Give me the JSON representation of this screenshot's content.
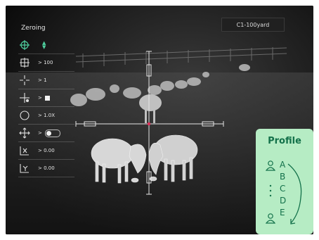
{
  "menu": {
    "title": "Zeroing",
    "items": [
      {
        "icon": "zero-reticle-icon",
        "value": "",
        "active": true
      },
      {
        "icon": "distance-icon",
        "value": "> 100",
        "active": false
      },
      {
        "icon": "reticle-type-icon",
        "value": "> 1",
        "active": false
      },
      {
        "icon": "reticle-color-icon",
        "value": ">",
        "active": false
      },
      {
        "icon": "zoom-circle-icon",
        "value": "> 1.0X",
        "active": false
      },
      {
        "icon": "freeze-icon",
        "value": ">",
        "active": false
      },
      {
        "icon": "x-axis-icon",
        "value": "> 0.00",
        "active": false
      },
      {
        "icon": "y-axis-icon",
        "value": "> 0.00",
        "active": false
      }
    ]
  },
  "badge": {
    "text": "C1-100yard"
  },
  "profile": {
    "title": "Profile",
    "items": [
      "A",
      "B",
      "C",
      "D",
      "E"
    ],
    "accent": "#13714a",
    "background": "#b6ecc4"
  }
}
